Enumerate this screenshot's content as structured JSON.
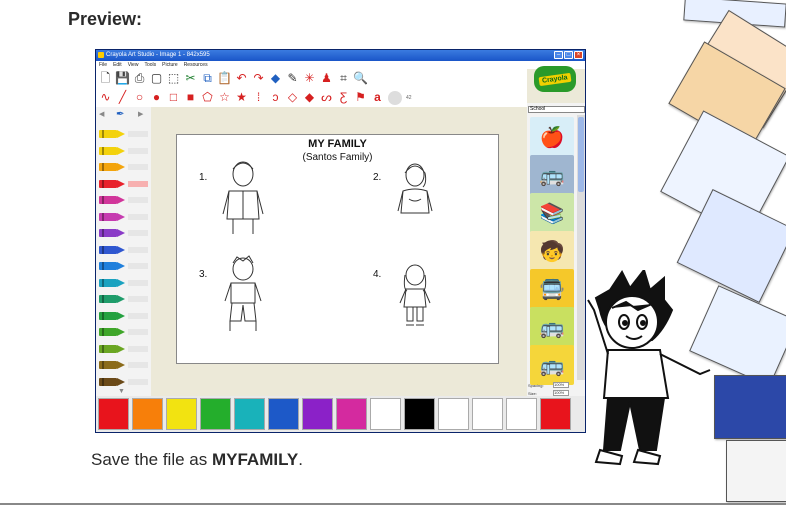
{
  "heading": "Preview:",
  "caption": {
    "prefix": "Save the file as ",
    "filename": "MYFAMILY",
    "suffix": "."
  },
  "app": {
    "title": "Crayola Art Studio - Image 1 - 842x595",
    "menus": [
      "File",
      "Edit",
      "View",
      "Tools",
      "Picture",
      "Resources"
    ],
    "logo_text": "Crayola",
    "gallery_category": "School",
    "spacing_label": "Spacing:",
    "spacing_value": "100%",
    "size_label": "Size:",
    "size_value": "100%",
    "font_size_value": "42"
  },
  "canvas": {
    "title": "MY FAMILY",
    "subtitle": "(Santos Family)",
    "members": [
      {
        "number": "1."
      },
      {
        "number": "2."
      },
      {
        "number": "3."
      },
      {
        "number": "4."
      }
    ]
  },
  "icons": {
    "toolbar_row1": [
      "new-file-icon",
      "save-icon",
      "print-icon",
      "blank-icon",
      "select-icon",
      "scissors-icon",
      "copy-icon",
      "paste-icon",
      "undo-icon",
      "redo-icon",
      "eraser-icon",
      "eyedropper-icon",
      "sparkle-icon",
      "stamp-icon",
      "crop-icon",
      "zoom-icon"
    ],
    "toolbar_row2": [
      "curve-icon",
      "line-icon",
      "circle-outline-icon",
      "circle-fill-icon",
      "square-outline-icon",
      "square-fill-icon",
      "pentagon-icon",
      "star-outline-icon",
      "star-fill-icon",
      "dotted-icon",
      "lasso-icon",
      "shape-icon",
      "shape-fill-icon",
      "zigzag-icon",
      "zigzag-fill-icon",
      "flag-icon",
      "text-icon"
    ]
  },
  "colors": {
    "crayons": [
      "#f3d20c",
      "#f3d20c",
      "#f3a40c",
      "#e8222c",
      "#d1359a",
      "#c63cb0",
      "#8a3bc7",
      "#2f57d0",
      "#1f7fdc",
      "#1aa2c0",
      "#1e9c6a",
      "#24a140",
      "#3fa629",
      "#6aa622",
      "#8b6b1a",
      "#6b4a18"
    ],
    "palette": [
      "#e8141c",
      "#f77f0a",
      "#f2e311",
      "#24ae2c",
      "#19b2ba",
      "#1d59c8",
      "#8b21c8",
      "#d42a9f",
      "#ffffff",
      "#000000",
      "#ffffff",
      "#ffffff",
      "#ffffff",
      "#e8141c"
    ],
    "gallery": [
      "#d8eef8",
      "#9fb6d0",
      "#cce6a8",
      "#f5e7b0",
      "#f5c82a",
      "#c9e060",
      "#f5d63a"
    ]
  }
}
